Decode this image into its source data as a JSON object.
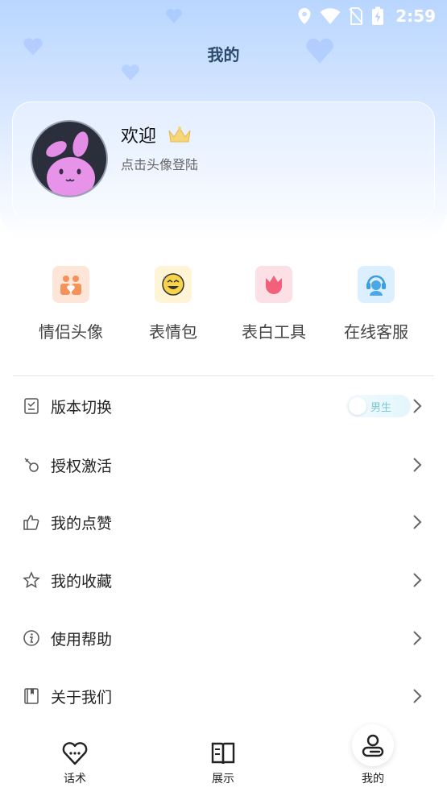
{
  "status_bar": {
    "time": "2:59",
    "icons": [
      "location-icon",
      "wifi-icon",
      "no-sim-icon",
      "battery-charging-icon"
    ]
  },
  "header": {
    "title": "我的"
  },
  "profile": {
    "welcome": "欢迎",
    "login_hint": "点击头像登陆",
    "avatar_icon": "pink-bunny-avatar",
    "badge_icon": "crown-icon"
  },
  "quick_actions": [
    {
      "label": "情侣头像",
      "icon": "couple-avatar-icon",
      "color": "#f5a06a"
    },
    {
      "label": "表情包",
      "icon": "emoji-icon",
      "color": "#f5c842"
    },
    {
      "label": "表白工具",
      "icon": "tulip-icon",
      "color": "#f2607a"
    },
    {
      "label": "在线客服",
      "icon": "customer-service-icon",
      "color": "#4aa8e8"
    }
  ],
  "menu": [
    {
      "label": "版本切换",
      "icon": "version-switch-icon",
      "toggle": "男生"
    },
    {
      "label": "授权激活",
      "icon": "key-icon"
    },
    {
      "label": "我的点赞",
      "icon": "thumbs-up-icon"
    },
    {
      "label": "我的收藏",
      "icon": "star-icon"
    },
    {
      "label": "使用帮助",
      "icon": "info-icon"
    },
    {
      "label": "关于我们",
      "icon": "book-icon"
    }
  ],
  "tabbar": [
    {
      "label": "话术",
      "icon": "heart-chat-icon"
    },
    {
      "label": "展示",
      "icon": "open-book-icon"
    },
    {
      "label": "我的",
      "icon": "profile-icon",
      "active": true
    }
  ]
}
